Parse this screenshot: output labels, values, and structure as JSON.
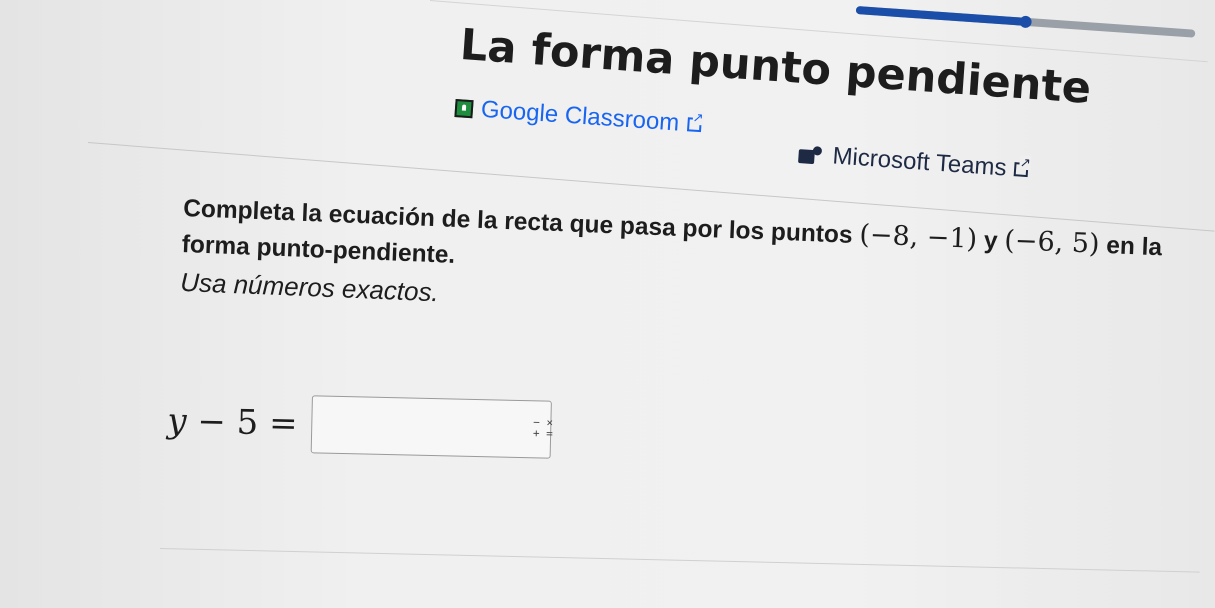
{
  "progress": {
    "value_fraction": 0.5,
    "fill_color": "#1b4ea8",
    "track_color": "#9aa0a8"
  },
  "header": {
    "title": "La forma punto pendiente"
  },
  "share": {
    "classroom_label": "Google Classroom",
    "teams_label": "Microsoft Teams",
    "classroom_icon": "google-classroom-icon",
    "teams_icon": "microsoft-teams-icon",
    "external_icon": "external-link-icon",
    "link_color": "#1865f2"
  },
  "question": {
    "prompt_before": "Completa la ecuación de la recta que pasa por los puntos",
    "point1": "(−8, −1)",
    "conjunction": "y",
    "point2": "(−6, 5)",
    "prompt_after": "en la forma punto-pendiente.",
    "instruction": "Usa números exactos."
  },
  "equation": {
    "lhs_var": "y",
    "lhs_rest": " − 5 =",
    "answer_value": "",
    "keypad_icon": "math-keypad-icon",
    "keypad_symbols_top": "− ×",
    "keypad_symbols_bottom": "+ ="
  }
}
